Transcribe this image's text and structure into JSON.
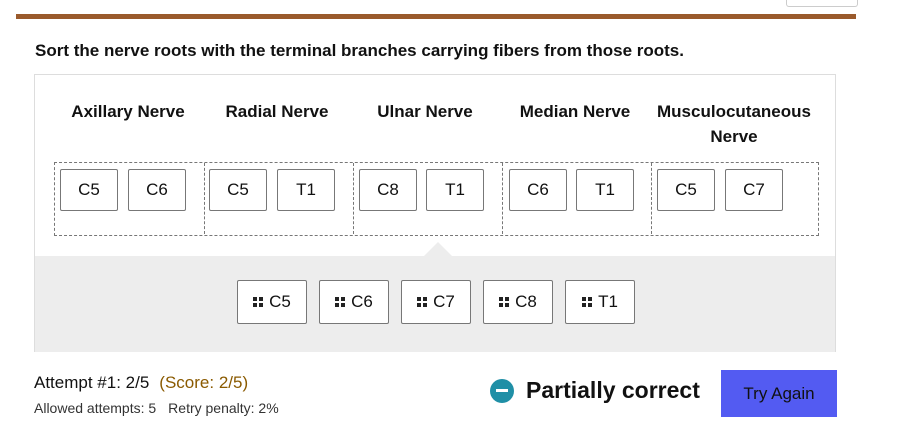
{
  "question": "Sort the nerve roots with the terminal branches carrying fibers from those roots.",
  "nerves": [
    {
      "name": "Axillary Nerve",
      "placed": [
        "C5",
        "C6"
      ]
    },
    {
      "name": "Radial Nerve",
      "placed": [
        "C5",
        "T1"
      ]
    },
    {
      "name": "Ulnar Nerve",
      "placed": [
        "C8",
        "T1"
      ]
    },
    {
      "name": "Median Nerve",
      "placed": [
        "C6",
        "T1"
      ]
    },
    {
      "name": "Musculocutaneous Nerve",
      "placed": [
        "C5",
        "C7"
      ]
    }
  ],
  "options": [
    "C5",
    "C6",
    "C7",
    "C8",
    "T1"
  ],
  "attempt": {
    "label": "Attempt #1: 2/5",
    "score": "(Score: 2/5)",
    "allowed": "Allowed attempts: 5",
    "penalty": "Retry penalty: 2%"
  },
  "status": {
    "text": "Partially correct",
    "icon": "minus-circle-icon",
    "color": "#1f8fa6"
  },
  "try_again_label": "Try Again",
  "colors": {
    "accent_bar": "#9a5a2c",
    "button": "#535bf2",
    "score_text": "#8a5a00"
  }
}
